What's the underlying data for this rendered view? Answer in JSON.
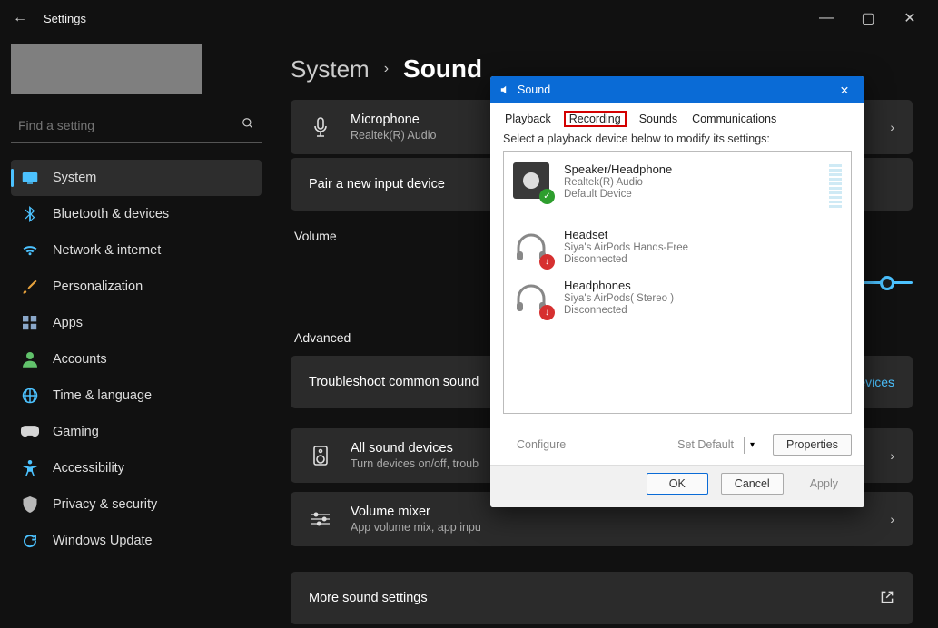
{
  "titlebar": {
    "title": "Settings"
  },
  "search": {
    "placeholder": "Find a setting"
  },
  "nav": {
    "items": [
      {
        "label": "System",
        "icon_color": "#4cc2ff"
      },
      {
        "label": "Bluetooth & devices",
        "icon_color": "#4cc2ff"
      },
      {
        "label": "Network & internet",
        "icon_color": "#4cc2ff"
      },
      {
        "label": "Personalization",
        "icon_color": "#e8a33d"
      },
      {
        "label": "Apps",
        "icon_color": "#8aa7c9"
      },
      {
        "label": "Accounts",
        "icon_color": "#61c26b"
      },
      {
        "label": "Time & language",
        "icon_color": "#4cc2ff"
      },
      {
        "label": "Gaming",
        "icon_color": "#d6d6d6"
      },
      {
        "label": "Accessibility",
        "icon_color": "#4cc2ff"
      },
      {
        "label": "Privacy & security",
        "icon_color": "#b9b9b9"
      },
      {
        "label": "Windows Update",
        "icon_color": "#4cc2ff"
      }
    ]
  },
  "breadcrumb": {
    "parent": "System",
    "current": "Sound"
  },
  "main": {
    "microphone": {
      "title": "Microphone",
      "sub": "Realtek(R) Audio"
    },
    "pair": {
      "title": "Pair a new input device"
    },
    "volume_head": "Volume",
    "advanced_head": "Advanced",
    "troubleshoot": {
      "title": "Troubleshoot common sound"
    },
    "devices_link": "evices",
    "all_devices": {
      "title": "All sound devices",
      "sub": "Turn devices on/off, troub"
    },
    "mixer": {
      "title": "Volume mixer",
      "sub": "App volume mix, app inpu"
    },
    "more": {
      "title": "More sound settings"
    }
  },
  "dialog": {
    "title": "Sound",
    "tabs": {
      "playback": "Playback",
      "recording": "Recording",
      "sounds": "Sounds",
      "comms": "Communications"
    },
    "instruction": "Select a playback device below to modify its settings:",
    "devices": [
      {
        "title": "Speaker/Headphone",
        "sub1": "Realtek(R) Audio",
        "sub2": "Default Device"
      },
      {
        "title": "Headset",
        "sub1": "Siya's AirPods Hands-Free",
        "sub2": "Disconnected"
      },
      {
        "title": "Headphones",
        "sub1": "Siya's AirPods( Stereo )",
        "sub2": "Disconnected"
      }
    ],
    "buttons": {
      "configure": "Configure",
      "set_default": "Set Default",
      "properties": "Properties",
      "ok": "OK",
      "cancel": "Cancel",
      "apply": "Apply"
    }
  }
}
